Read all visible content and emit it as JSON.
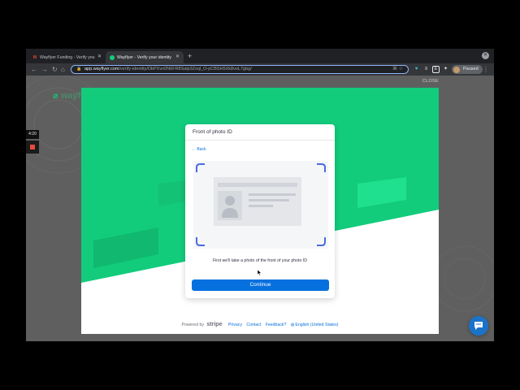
{
  "browser": {
    "tabs": [
      {
        "label": "Wayflyer Funding - Verify you",
        "favicon": "gmail-icon"
      },
      {
        "label": "Wayflyer - Verify your identity",
        "favicon": "wayflyer-icon",
        "active": true
      }
    ],
    "url_host": "app.wayflyer.com",
    "url_path": "/verify-identity/DbPXvn0N6FR8Salp3Zsql_O-pCBSH5Xk8voL7gbg/",
    "profile_label": "Paused"
  },
  "page": {
    "logo_text": "wayfl",
    "close_label": "CLOSE",
    "recorder_time": "4:20"
  },
  "verify": {
    "title": "Front of photo ID",
    "back_label": "← Back",
    "caption": "First we'll take a photo of the front of your photo ID",
    "continue_label": "Continue"
  },
  "footer": {
    "powered_by": "Powered by",
    "brand": "stripe",
    "privacy": "Privacy",
    "contact": "Contact",
    "feedback": "Feedback?",
    "language": "English (United States)"
  },
  "colors": {
    "accent_green": "#12cc7c",
    "button_blue": "#0570de",
    "chat_blue": "#1a73c9"
  }
}
